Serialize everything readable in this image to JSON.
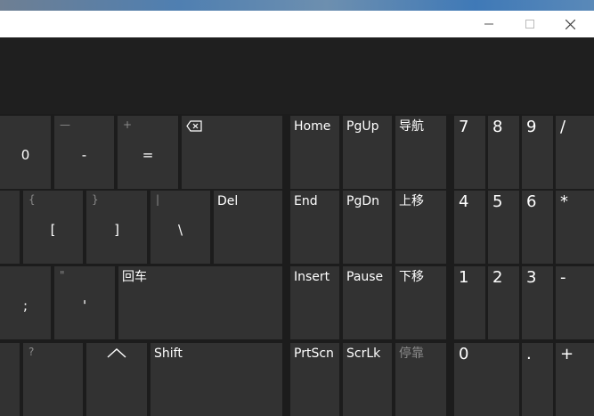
{
  "window": {
    "buttons": {
      "minimize": "minimize-icon",
      "maximize": "maximize-icon",
      "close": "close-icon"
    }
  },
  "keys": {
    "row1": [
      {
        "main": "0"
      },
      {
        "main": "-",
        "sec": "—"
      },
      {
        "main": "=",
        "sec": "+"
      },
      {
        "icon": "backspace-icon"
      }
    ],
    "row2": [
      {
        "main": "[",
        "sec": "{"
      },
      {
        "main": "]",
        "sec": "}"
      },
      {
        "main": "\\",
        "sec": "|"
      },
      {
        "main": "Del"
      }
    ],
    "row3": [
      {
        "main": ";"
      },
      {
        "main": "'",
        "sec": "\""
      },
      {
        "main": "回车"
      }
    ],
    "row4": [
      {
        "sec": "?"
      },
      {
        "icon": "arrow-up-icon"
      },
      {
        "main": "Shift"
      }
    ],
    "nav": {
      "home": "Home",
      "pgup": "PgUp",
      "nav_cn": "导航",
      "end": "End",
      "pgdn": "PgDn",
      "up_cn": "上移",
      "insert": "Insert",
      "pause": "Pause",
      "down_cn": "下移",
      "prtscn": "PrtScn",
      "scrlk": "ScrLk",
      "dock_cn": "停靠"
    },
    "numpad": {
      "r1": [
        "7",
        "8",
        "9",
        "/"
      ],
      "r2": [
        "4",
        "5",
        "6",
        "*"
      ],
      "r3": [
        "1",
        "2",
        "3",
        "-"
      ],
      "r4": [
        "0",
        ".",
        "+"
      ]
    }
  },
  "colors": {
    "key": "#323232",
    "background": "#1c1c1c",
    "secondary_text": "#8a8a8a",
    "titlebar": "#ffffff"
  }
}
